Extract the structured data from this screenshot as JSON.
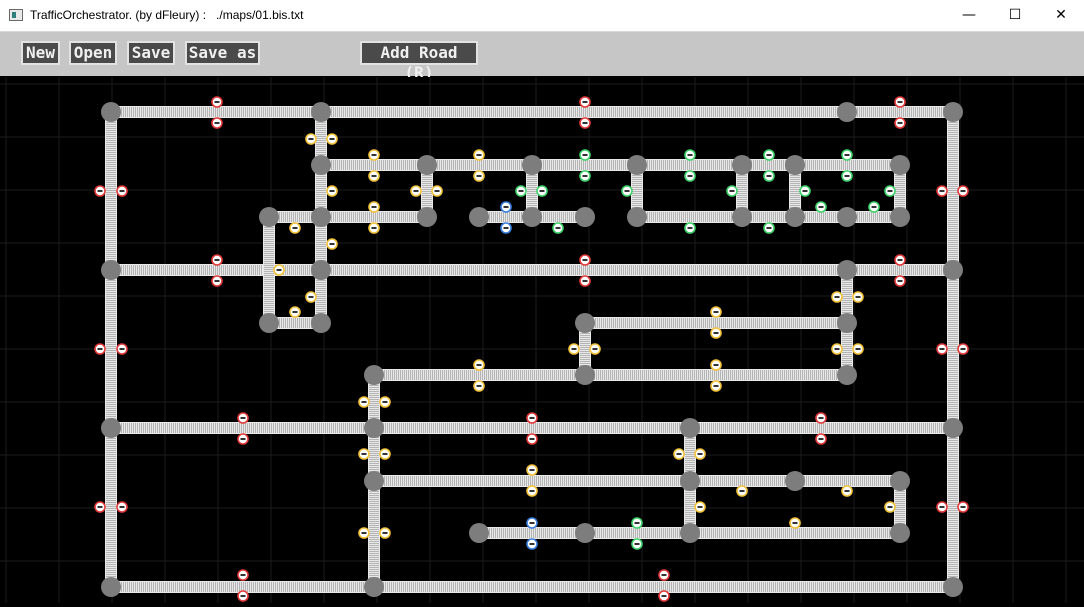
{
  "window": {
    "title": "TrafficOrchestrator. (by dFleury) :   ./maps/01.bis.txt",
    "minimize_glyph": "—",
    "maximize_glyph": "☐",
    "close_glyph": "✕"
  },
  "toolbar": {
    "new_label": "New",
    "open_label": "Open",
    "save_label": "Save",
    "save_as_label": "Save as",
    "add_road_label": "Add Road (R)"
  },
  "colors": {
    "background": "#000000",
    "grid": "#1c1c1c",
    "road": "#b4b4b4",
    "node": "#7d7d7d",
    "toolbar": "#c6c6c6",
    "button": "#4a4a4a",
    "signal_red": "#e23a3a",
    "signal_yellow": "#f2c23a",
    "signal_green": "#3fd36a",
    "signal_blue": "#3b7fe0"
  },
  "map": {
    "signal_ring_colors": [
      "red",
      "yellow",
      "green",
      "blue"
    ]
  }
}
